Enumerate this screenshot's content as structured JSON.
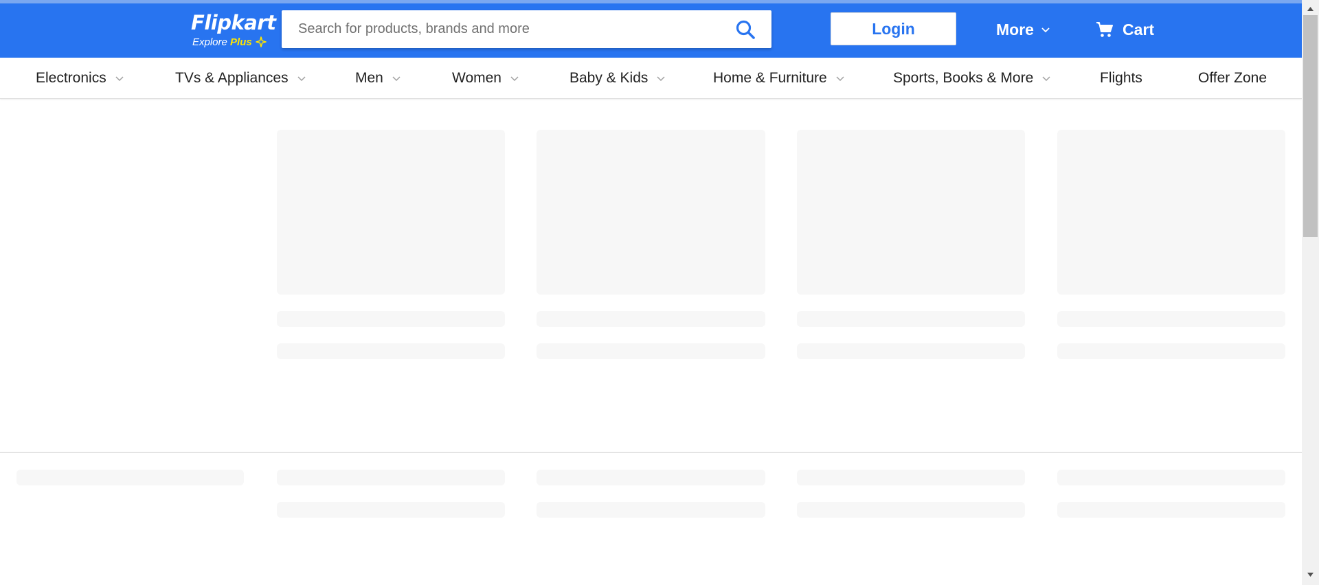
{
  "colors": {
    "brand_blue": "#2874f0",
    "brand_yellow": "#ffe500",
    "skeleton": "#f7f7f7"
  },
  "header": {
    "logo": {
      "title": "Flipkart",
      "subtitle_explore": "Explore",
      "subtitle_plus": "Plus",
      "plus_icon": "plus-star-icon"
    },
    "search": {
      "placeholder": "Search for products, brands and more",
      "value": "",
      "icon": "search-icon"
    },
    "login_label": "Login",
    "more_label": "More",
    "cart_label": "Cart"
  },
  "categories": [
    {
      "label": "Electronics",
      "has_dropdown": true
    },
    {
      "label": "TVs & Appliances",
      "has_dropdown": true
    },
    {
      "label": "Men",
      "has_dropdown": true
    },
    {
      "label": "Women",
      "has_dropdown": true
    },
    {
      "label": "Baby & Kids",
      "has_dropdown": true
    },
    {
      "label": "Home & Furniture",
      "has_dropdown": true
    },
    {
      "label": "Sports, Books & More",
      "has_dropdown": true
    },
    {
      "label": "Flights",
      "has_dropdown": false
    },
    {
      "label": "Offer Zone",
      "has_dropdown": false
    }
  ],
  "content": {
    "state": "loading"
  }
}
